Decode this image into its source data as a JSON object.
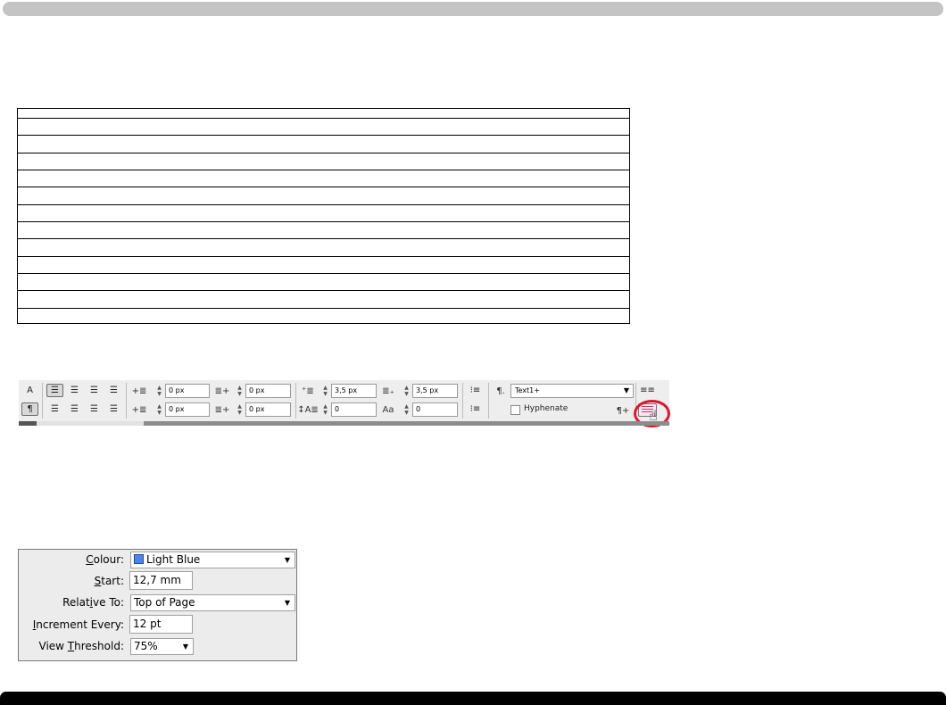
{
  "toolbar": {
    "char_mode_label": "A",
    "para_mode_label": "¶",
    "left_indent": "0 px",
    "right_indent": "0 px",
    "first_line_indent": "0 px",
    "last_line_indent": "0 px",
    "space_before": "3,5 px",
    "space_after": "3,5 px",
    "drop_cap_lines": "0",
    "drop_cap_chars": "0",
    "paragraph_style": "Text1+",
    "hyphenate_label": "Hyphenate",
    "hyphenate_checked": false
  },
  "dialog": {
    "colour_label": "Colour:",
    "colour_value": "Light Blue",
    "colour_swatch": "#4a86e8",
    "start_label": "Start:",
    "start_value": "12,7 mm",
    "relative_label": "Relative To:",
    "relative_value": "Top of Page",
    "increment_label": "Increment Every:",
    "increment_value": "12 pt",
    "threshold_label": "View Threshold:",
    "threshold_value": "75%"
  },
  "colors": {
    "highlight_circle": "#e0142a",
    "align_icon": "#c23a6f"
  }
}
